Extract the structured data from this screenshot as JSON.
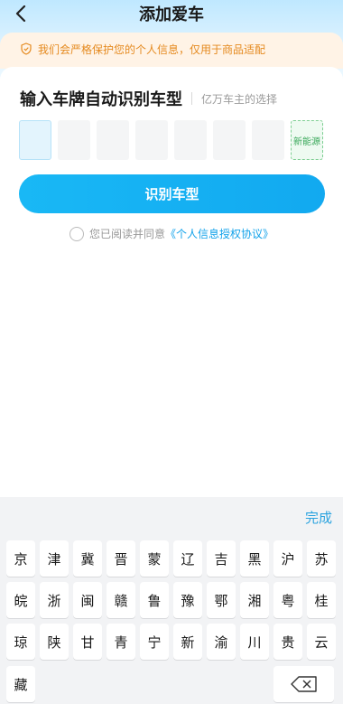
{
  "nav": {
    "title": "添加爱车"
  },
  "notice": {
    "text": "我们会严格保护您的个人信息，仅用于商品适配",
    "color": "#e58a1f"
  },
  "form": {
    "title": "输入车牌自动识别车型",
    "subtitle": "亿万车主的选择",
    "new_energy_label": "新能源",
    "recognize_label": "识别车型",
    "agree_text": "您已阅读并同意",
    "agree_link": "《个人信息授权协议》"
  },
  "keyboard": {
    "done_label": "完成",
    "rows": [
      [
        "京",
        "津",
        "冀",
        "晋",
        "蒙",
        "辽",
        "吉",
        "黑",
        "沪",
        "苏"
      ],
      [
        "皖",
        "浙",
        "闽",
        "赣",
        "鲁",
        "豫",
        "鄂",
        "湘",
        "粤",
        "桂"
      ],
      [
        "琼",
        "陕",
        "甘",
        "青",
        "宁",
        "新",
        "渝",
        "川",
        "贵",
        "云"
      ],
      [
        "藏"
      ]
    ],
    "delete_icon": "backspace-icon"
  },
  "colors": {
    "accent": "#12a9f0",
    "notice_bg": "#fff3e6",
    "new_energy": "#3aa85a"
  }
}
